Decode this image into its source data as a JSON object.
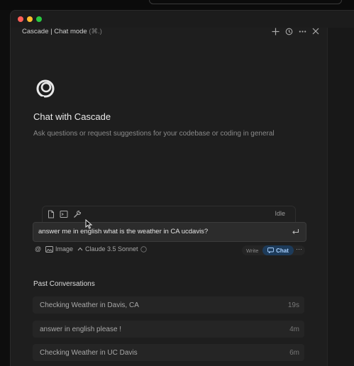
{
  "header": {
    "title": "Cascade | Chat mode",
    "shortcut": "(⌘.)",
    "icons": [
      "plus-icon",
      "history-icon",
      "more-icon",
      "close-icon"
    ]
  },
  "hero": {
    "title": "Chat with Cascade",
    "subtitle": "Ask questions or request suggestions for your codebase or coding in general"
  },
  "composer": {
    "status": "Idle",
    "input_value": "answer me in english what is the weather in CA ucdavis?",
    "image_label": "Image",
    "model_label": "Claude 3.5 Sonnet",
    "mode_write": "Write",
    "mode_chat": "Chat"
  },
  "past": {
    "title": "Past Conversations",
    "items": [
      {
        "name": "Checking Weather in Davis, CA",
        "time": "19s"
      },
      {
        "name": "answer in english please !",
        "time": "4m"
      },
      {
        "name": "Checking Weather in UC Davis",
        "time": "6m"
      }
    ]
  },
  "colors": {
    "accent": "#1d3b5a",
    "accent_text": "#a9d0ff",
    "close": "#ff5f57",
    "minimize": "#febc2e",
    "zoom": "#28c840"
  }
}
